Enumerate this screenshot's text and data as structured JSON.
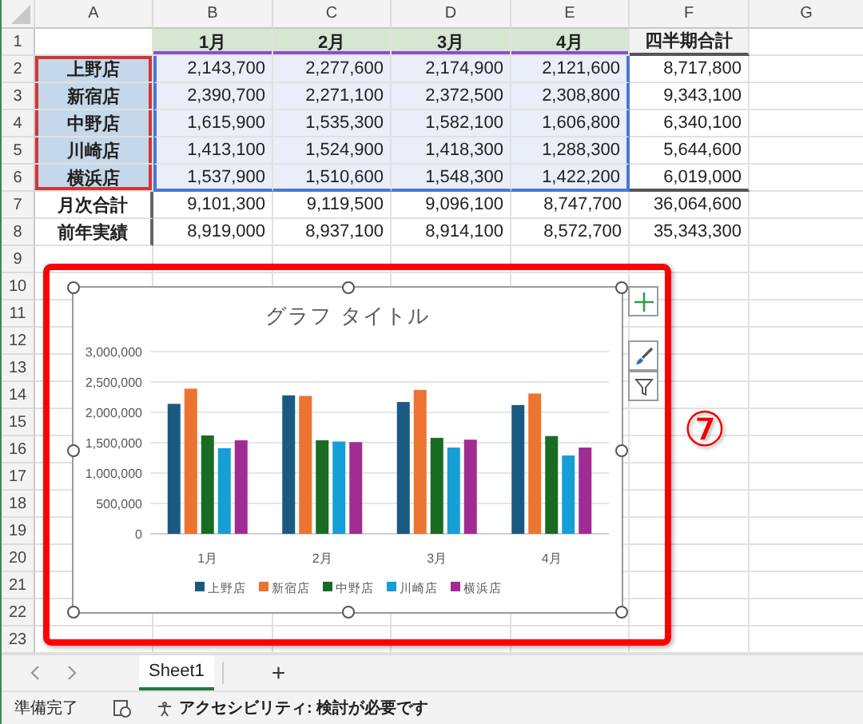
{
  "columns": [
    "A",
    "B",
    "C",
    "D",
    "E",
    "F",
    "G"
  ],
  "rows": [
    {
      "number": "1",
      "kind": "header",
      "cells": [
        "1月",
        "2月",
        "3月",
        "4月",
        "四半期合計"
      ]
    },
    {
      "number": "2",
      "kind": "series",
      "label": "上野店",
      "cells": [
        "2,143,700",
        "2,277,600",
        "2,174,900",
        "2,121,600",
        "8,717,800"
      ]
    },
    {
      "number": "3",
      "kind": "series",
      "label": "新宿店",
      "cells": [
        "2,390,700",
        "2,271,100",
        "2,372,500",
        "2,308,800",
        "9,343,100"
      ]
    },
    {
      "number": "4",
      "kind": "series",
      "label": "中野店",
      "cells": [
        "1,615,900",
        "1,535,300",
        "1,582,100",
        "1,606,800",
        "6,340,100"
      ]
    },
    {
      "number": "5",
      "kind": "series",
      "label": "川崎店",
      "cells": [
        "1,413,100",
        "1,524,900",
        "1,418,300",
        "1,288,300",
        "5,644,600"
      ]
    },
    {
      "number": "6",
      "kind": "series",
      "label": "横浜店",
      "cells": [
        "1,537,900",
        "1,510,600",
        "1,548,300",
        "1,422,200",
        "6,019,000"
      ]
    },
    {
      "number": "7",
      "kind": "total",
      "label": "月次合計",
      "cells": [
        "9,101,300",
        "9,119,500",
        "9,096,100",
        "8,747,700",
        "36,064,600"
      ]
    },
    {
      "number": "8",
      "kind": "total",
      "label": "前年実績",
      "cells": [
        "8,919,000",
        "8,937,100",
        "8,914,100",
        "8,572,700",
        "35,343,300"
      ]
    },
    {
      "number": "9",
      "kind": "empty"
    },
    {
      "number": "10",
      "kind": "empty"
    },
    {
      "number": "11",
      "kind": "empty"
    },
    {
      "number": "12",
      "kind": "empty"
    },
    {
      "number": "13",
      "kind": "empty"
    },
    {
      "number": "14",
      "kind": "empty"
    },
    {
      "number": "15",
      "kind": "empty"
    },
    {
      "number": "16",
      "kind": "empty"
    },
    {
      "number": "17",
      "kind": "empty"
    },
    {
      "number": "18",
      "kind": "empty"
    },
    {
      "number": "19",
      "kind": "empty"
    },
    {
      "number": "20",
      "kind": "empty"
    },
    {
      "number": "21",
      "kind": "empty"
    },
    {
      "number": "22",
      "kind": "empty"
    },
    {
      "number": "23",
      "kind": "empty"
    }
  ],
  "chart": {
    "selected": true,
    "chart_data": {
      "type": "bar",
      "title": "グラフ タイトル",
      "grid": true,
      "legend": true,
      "categories": [
        "1月",
        "2月",
        "3月",
        "4月"
      ],
      "ylim": [
        0,
        3000000
      ],
      "yticks": [
        0,
        {
          "value": 500000,
          "label": "500,000"
        },
        {
          "value": 1000000,
          "label": "1,000,000"
        },
        {
          "value": 1500000,
          "label": "1,500,000"
        },
        {
          "value": 2000000,
          "label": "2,000,000"
        },
        {
          "value": 2500000,
          "label": "2,500,000"
        },
        {
          "value": 3000000,
          "label": "3,000,000"
        }
      ],
      "series": [
        {
          "name": "上野店",
          "color": "#1a5a80",
          "values": [
            2140000,
            2280000,
            2170000,
            2120000
          ]
        },
        {
          "name": "新宿店",
          "color": "#ed7331",
          "values": [
            2390000,
            2270000,
            2370000,
            2310000
          ]
        },
        {
          "name": "中野店",
          "color": "#196b24",
          "values": [
            1620000,
            1540000,
            1580000,
            1610000
          ]
        },
        {
          "name": "川崎店",
          "color": "#159fd6",
          "values": [
            1410000,
            1520000,
            1420000,
            1290000
          ]
        },
        {
          "name": "横浜店",
          "color": "#a02b93",
          "values": [
            1540000,
            1510000,
            1550000,
            1420000
          ]
        }
      ]
    }
  },
  "annotation": {
    "label": "⑦"
  },
  "sheet_tabs": [
    {
      "label": "Sheet1",
      "selected": true
    }
  ],
  "add_sheet": "+",
  "status_bar": {
    "ready": "準備完了",
    "accessibility": "アクセシビリティ: 検討が必要です"
  }
}
